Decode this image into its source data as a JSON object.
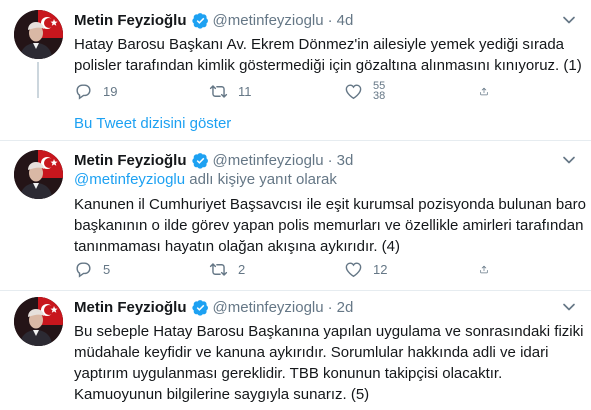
{
  "tweets": [
    {
      "name": "Metin Feyzioğlu",
      "handle": "@metinfeyzioglu",
      "dot": "·",
      "time": "4d",
      "lines": [
        "Hatay Barosu Başkanı Av. Ekrem Dönmez'in ailesiyle yemek yediği sırada",
        "polisler tarafından kimlik göstermediği için gözaltına alınmasını kınıyoruz. (1)"
      ],
      "replies": "19",
      "retweets": "11",
      "likes": "55\n38"
    },
    {
      "name": "Metin Feyzioğlu",
      "handle": "@metinfeyzioglu",
      "dot": "·",
      "time": "3d",
      "reply_prefix": "",
      "reply_mention": "@metinfeyzioglu",
      "reply_suffix": " adlı kişiye yanıt olarak",
      "lines": [
        "Kanunen il Cumhuriyet Başsavcısı ile eşit kurumsal pozisyonda bulunan baro",
        "başkanının o ilde görev yapan polis memurları ve özellikle amirleri tarafından",
        "tanınmaması hayatın olağan akışına aykırıdır. (4)"
      ],
      "replies": "5",
      "retweets": "2",
      "likes": "12"
    },
    {
      "name": "Metin Feyzioğlu",
      "handle": "@metinfeyzioglu",
      "dot": "·",
      "time": "2d",
      "lines": [
        "Bu sebeple Hatay Barosu Başkanına  yapılan uygulama ve sonrasındaki fiziki",
        "müdahale keyfidir ve  kanuna aykırıdır. Sorumlular hakkında adli ve idari",
        "yaptırım uygulanması gereklidir.  TBB konunun takipçisi olacaktır.",
        "Kamuoyunun bilgilerine saygıyla sunarız. (5)"
      ]
    }
  ],
  "show_thread": "Bu Tweet dizisini göster",
  "colors": {
    "accent": "#1da1f2",
    "muted": "#657786",
    "text": "#14171a",
    "border": "#e6ecf0"
  },
  "icons": [
    "verified-badge-icon",
    "chevron-down-icon",
    "reply-icon",
    "retweet-icon",
    "like-icon",
    "share-icon"
  ]
}
